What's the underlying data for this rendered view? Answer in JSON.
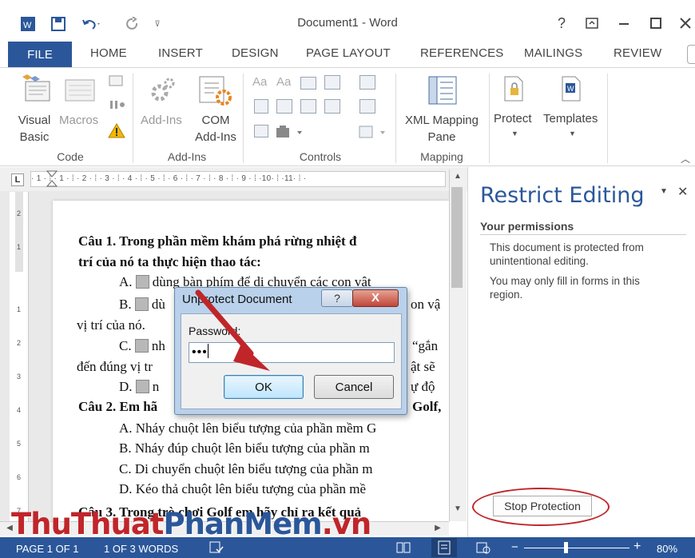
{
  "window": {
    "title": "Document1 - Word",
    "help": "?"
  },
  "tabs": [
    "FILE",
    "HOME",
    "INSERT",
    "DESIGN",
    "PAGE LAYOUT",
    "REFERENCES",
    "MAILINGS",
    "REVIEW"
  ],
  "ribbon": {
    "code": {
      "visual_basic_1": "Visual",
      "visual_basic_2": "Basic",
      "macros": "Macros",
      "group": "Code"
    },
    "addins": {
      "addins": "Add-Ins",
      "com_1": "COM",
      "com_2": "Add-Ins",
      "group": "Add-Ins"
    },
    "controls": {
      "group": "Controls",
      "aa1": "Aa",
      "aa2": "Aa"
    },
    "mapping": {
      "xml_1": "XML Mapping",
      "xml_2": "Pane",
      "group": "Mapping"
    },
    "protect": {
      "label": "Protect"
    },
    "templates": {
      "label": "Templates"
    }
  },
  "ruler": {
    "text": "· 1 · ⁞ · 1 · ⁞ · 2 · ⁞ · 3 · ⁞ · 4 · ⁞ · 5 · ⁞ · 6 · ⁞ · 7 · ⁞ · 8 · ⁞ · 9 · ⁞ ·10· ⁞ ·11· ⁞ ·"
  },
  "document": {
    "l1": "Câu 1. Trong phần mềm khám phá rừng nhiệt đ",
    "l2": "trí của nó ta thực hiện thao tác:",
    "l3": "dùng bàn phím để di chuyển các con vật",
    "l3a": "A.",
    "l4a": "B.",
    "l4": "dù",
    "l4r": "on vậ",
    "l5": "vị trí của nó.",
    "l6a": "C.",
    "l6": "nh",
    "l6r": "“gắn",
    "l7": "đến đúng vị tr",
    "l7r": "ật sẽ",
    "l8a": "D.",
    "l8": "n",
    "l8r": "ự độ",
    "l9": "Câu 2. Em hã",
    "l9r": "Golf,",
    "l10": "A. Nháy chuột lên biểu tượng của phần mềm G",
    "l11": "B. Nháy đúp chuột lên biểu tượng của phần m",
    "l12": "C. Di chuyển chuột lên biểu tượng của phần m",
    "l13": "D. Kéo thả chuột lên biểu tượng của phần mề",
    "l14": "Câu 3. Trong trò chơi Golf em hãy chỉ ra kết quả"
  },
  "pane": {
    "title": "Restrict Editing",
    "permissions": "Your permissions",
    "text1a": "This document is protected from",
    "text1b": "unintentional editing.",
    "text2a": "You may only fill in forms in this",
    "text2b": "region.",
    "stop": "Stop Protection"
  },
  "dialog": {
    "title": "Unprotect Document",
    "help": "?",
    "close": "X",
    "password_label": "Password:",
    "password_value": "•••",
    "ok": "OK",
    "cancel": "Cancel"
  },
  "status": {
    "page": "PAGE 1 OF 1",
    "words": "1 OF 3 WORDS",
    "zoom": "80%"
  },
  "watermark": {
    "part1": "ThuThuat",
    "part2": "PhanMem",
    "part3": ".vn"
  },
  "colors": {
    "accent": "#2b579a",
    "arrow": "#c0252a",
    "pane_title": "#2b579a"
  }
}
